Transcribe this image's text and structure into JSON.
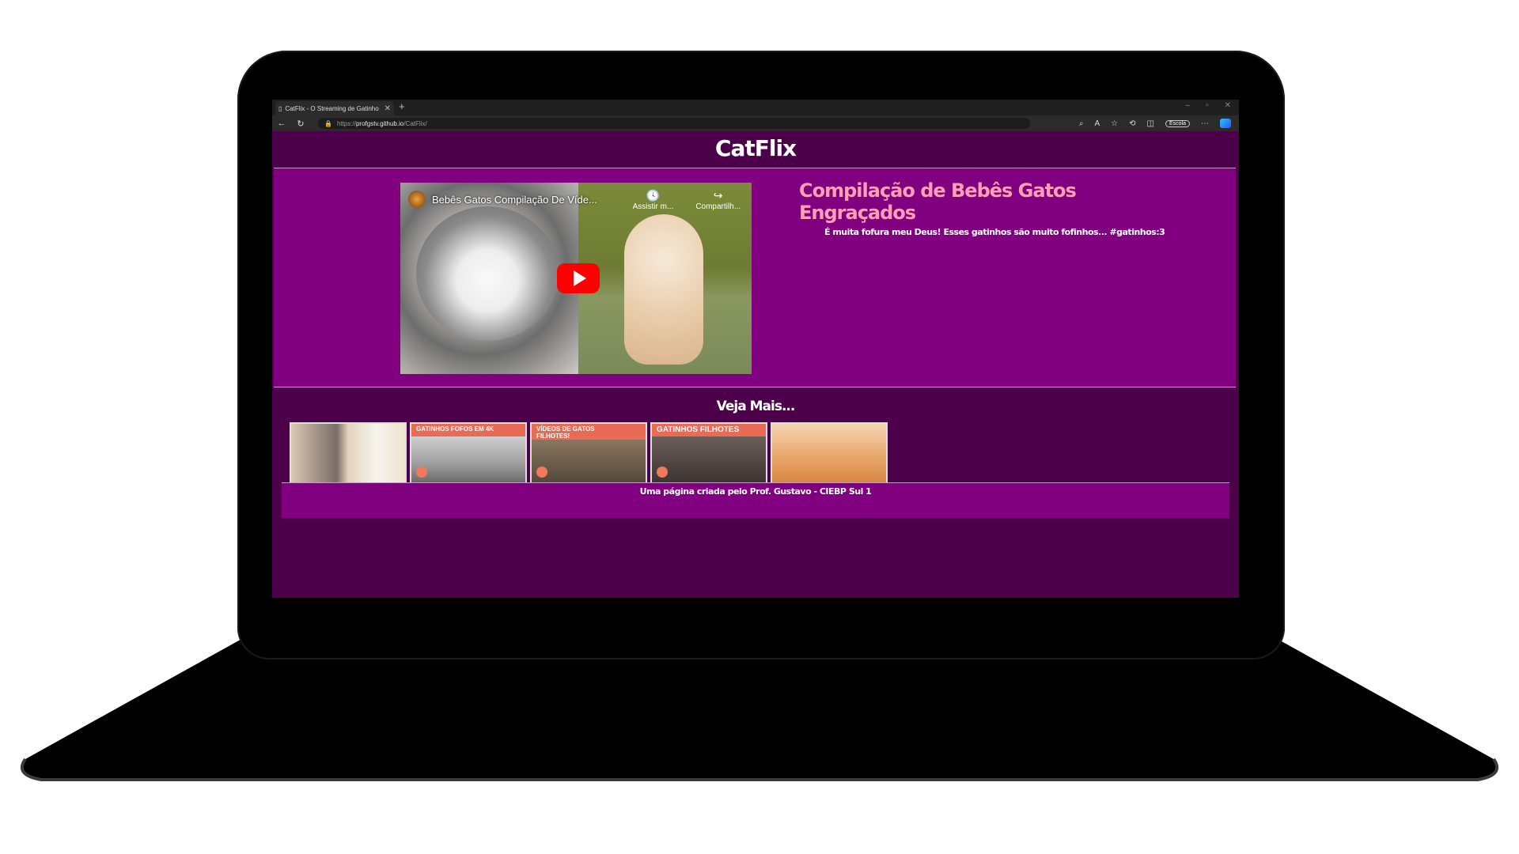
{
  "browser": {
    "tab_title": "CatFlix - O Streaming de Gatinho",
    "url_prefix": "https://",
    "url_host": "profgstv.github.io",
    "url_path": "/CatFlix/",
    "profile_label": "Escola"
  },
  "page": {
    "site_title": "CatFlix",
    "video": {
      "title": "Bebês Gatos Compilação De Víde...",
      "watch_later": "Assistir m...",
      "share": "Compartilh..."
    },
    "heading": "Compilação de Bebês Gatos Engraçados",
    "description": "É muita fofura meu Deus! Esses gatinhos são muito fofinhos... #gatinhos:3",
    "more_title": "Veja Mais...",
    "thumbnails": [
      {
        "caption": ""
      },
      {
        "caption": "GATINHOS FOFOS EM 4K"
      },
      {
        "caption": "VÍDEOS DE GATOS FILHOTES!"
      },
      {
        "caption": "GATINHOS FILHOTES"
      },
      {
        "caption": ""
      }
    ],
    "footer": "Uma página criada pelo Prof. Gustavo - CIEBP Sul 1"
  },
  "colors": {
    "page_dark": "#4b0049",
    "page_purple": "#800080",
    "heading_pink": "#ff9fb6",
    "youtube_red": "#ff0000"
  }
}
